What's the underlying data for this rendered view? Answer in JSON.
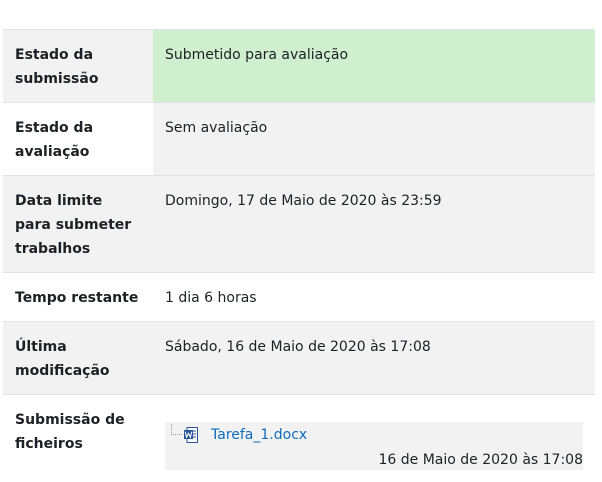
{
  "rows": [
    {
      "label": "Estado da submissão",
      "value": "Submetido para avaliação"
    },
    {
      "label": "Estado da avaliação",
      "value": "Sem avaliação"
    },
    {
      "label": "Data limite para submeter trabalhos",
      "value": "Domingo, 17 de Maio de 2020 às 23:59"
    },
    {
      "label": "Tempo restante",
      "value": "1 dia 6 horas"
    },
    {
      "label": "Última modificação",
      "value": "Sábado, 16 de Maio de 2020 às 17:08"
    },
    {
      "label": "Submissão de ficheiros",
      "value": ""
    }
  ],
  "file": {
    "name": "Tarefa_1.docx",
    "date": "16 de Maio de 2020 às 17:08",
    "icon": "word-document-icon"
  },
  "colors": {
    "submitted_bg": "#cfefcf",
    "stripe_bg": "#f2f2f2",
    "link": "#0f6cbf",
    "word_blue": "#2b579a"
  }
}
